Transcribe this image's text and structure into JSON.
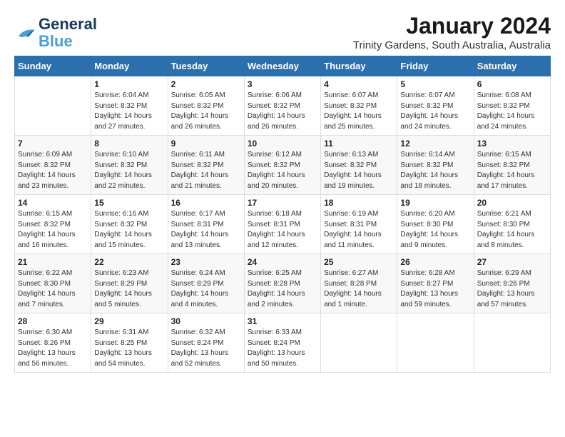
{
  "logo": {
    "line1": "General",
    "line2": "Blue"
  },
  "title": "January 2024",
  "subtitle": "Trinity Gardens, South Australia, Australia",
  "headers": [
    "Sunday",
    "Monday",
    "Tuesday",
    "Wednesday",
    "Thursday",
    "Friday",
    "Saturday"
  ],
  "weeks": [
    [
      {
        "day": "",
        "sunrise": "",
        "sunset": "",
        "daylight": ""
      },
      {
        "day": "1",
        "sunrise": "Sunrise: 6:04 AM",
        "sunset": "Sunset: 8:32 PM",
        "daylight": "Daylight: 14 hours and 27 minutes."
      },
      {
        "day": "2",
        "sunrise": "Sunrise: 6:05 AM",
        "sunset": "Sunset: 8:32 PM",
        "daylight": "Daylight: 14 hours and 26 minutes."
      },
      {
        "day": "3",
        "sunrise": "Sunrise: 6:06 AM",
        "sunset": "Sunset: 8:32 PM",
        "daylight": "Daylight: 14 hours and 26 minutes."
      },
      {
        "day": "4",
        "sunrise": "Sunrise: 6:07 AM",
        "sunset": "Sunset: 8:32 PM",
        "daylight": "Daylight: 14 hours and 25 minutes."
      },
      {
        "day": "5",
        "sunrise": "Sunrise: 6:07 AM",
        "sunset": "Sunset: 8:32 PM",
        "daylight": "Daylight: 14 hours and 24 minutes."
      },
      {
        "day": "6",
        "sunrise": "Sunrise: 6:08 AM",
        "sunset": "Sunset: 8:32 PM",
        "daylight": "Daylight: 14 hours and 24 minutes."
      }
    ],
    [
      {
        "day": "7",
        "sunrise": "Sunrise: 6:09 AM",
        "sunset": "Sunset: 8:32 PM",
        "daylight": "Daylight: 14 hours and 23 minutes."
      },
      {
        "day": "8",
        "sunrise": "Sunrise: 6:10 AM",
        "sunset": "Sunset: 8:32 PM",
        "daylight": "Daylight: 14 hours and 22 minutes."
      },
      {
        "day": "9",
        "sunrise": "Sunrise: 6:11 AM",
        "sunset": "Sunset: 8:32 PM",
        "daylight": "Daylight: 14 hours and 21 minutes."
      },
      {
        "day": "10",
        "sunrise": "Sunrise: 6:12 AM",
        "sunset": "Sunset: 8:32 PM",
        "daylight": "Daylight: 14 hours and 20 minutes."
      },
      {
        "day": "11",
        "sunrise": "Sunrise: 6:13 AM",
        "sunset": "Sunset: 8:32 PM",
        "daylight": "Daylight: 14 hours and 19 minutes."
      },
      {
        "day": "12",
        "sunrise": "Sunrise: 6:14 AM",
        "sunset": "Sunset: 8:32 PM",
        "daylight": "Daylight: 14 hours and 18 minutes."
      },
      {
        "day": "13",
        "sunrise": "Sunrise: 6:15 AM",
        "sunset": "Sunset: 8:32 PM",
        "daylight": "Daylight: 14 hours and 17 minutes."
      }
    ],
    [
      {
        "day": "14",
        "sunrise": "Sunrise: 6:15 AM",
        "sunset": "Sunset: 8:32 PM",
        "daylight": "Daylight: 14 hours and 16 minutes."
      },
      {
        "day": "15",
        "sunrise": "Sunrise: 6:16 AM",
        "sunset": "Sunset: 8:32 PM",
        "daylight": "Daylight: 14 hours and 15 minutes."
      },
      {
        "day": "16",
        "sunrise": "Sunrise: 6:17 AM",
        "sunset": "Sunset: 8:31 PM",
        "daylight": "Daylight: 14 hours and 13 minutes."
      },
      {
        "day": "17",
        "sunrise": "Sunrise: 6:18 AM",
        "sunset": "Sunset: 8:31 PM",
        "daylight": "Daylight: 14 hours and 12 minutes."
      },
      {
        "day": "18",
        "sunrise": "Sunrise: 6:19 AM",
        "sunset": "Sunset: 8:31 PM",
        "daylight": "Daylight: 14 hours and 11 minutes."
      },
      {
        "day": "19",
        "sunrise": "Sunrise: 6:20 AM",
        "sunset": "Sunset: 8:30 PM",
        "daylight": "Daylight: 14 hours and 9 minutes."
      },
      {
        "day": "20",
        "sunrise": "Sunrise: 6:21 AM",
        "sunset": "Sunset: 8:30 PM",
        "daylight": "Daylight: 14 hours and 8 minutes."
      }
    ],
    [
      {
        "day": "21",
        "sunrise": "Sunrise: 6:22 AM",
        "sunset": "Sunset: 8:30 PM",
        "daylight": "Daylight: 14 hours and 7 minutes."
      },
      {
        "day": "22",
        "sunrise": "Sunrise: 6:23 AM",
        "sunset": "Sunset: 8:29 PM",
        "daylight": "Daylight: 14 hours and 5 minutes."
      },
      {
        "day": "23",
        "sunrise": "Sunrise: 6:24 AM",
        "sunset": "Sunset: 8:29 PM",
        "daylight": "Daylight: 14 hours and 4 minutes."
      },
      {
        "day": "24",
        "sunrise": "Sunrise: 6:25 AM",
        "sunset": "Sunset: 8:28 PM",
        "daylight": "Daylight: 14 hours and 2 minutes."
      },
      {
        "day": "25",
        "sunrise": "Sunrise: 6:27 AM",
        "sunset": "Sunset: 8:28 PM",
        "daylight": "Daylight: 14 hours and 1 minute."
      },
      {
        "day": "26",
        "sunrise": "Sunrise: 6:28 AM",
        "sunset": "Sunset: 8:27 PM",
        "daylight": "Daylight: 13 hours and 59 minutes."
      },
      {
        "day": "27",
        "sunrise": "Sunrise: 6:29 AM",
        "sunset": "Sunset: 8:26 PM",
        "daylight": "Daylight: 13 hours and 57 minutes."
      }
    ],
    [
      {
        "day": "28",
        "sunrise": "Sunrise: 6:30 AM",
        "sunset": "Sunset: 8:26 PM",
        "daylight": "Daylight: 13 hours and 56 minutes."
      },
      {
        "day": "29",
        "sunrise": "Sunrise: 6:31 AM",
        "sunset": "Sunset: 8:25 PM",
        "daylight": "Daylight: 13 hours and 54 minutes."
      },
      {
        "day": "30",
        "sunrise": "Sunrise: 6:32 AM",
        "sunset": "Sunset: 8:24 PM",
        "daylight": "Daylight: 13 hours and 52 minutes."
      },
      {
        "day": "31",
        "sunrise": "Sunrise: 6:33 AM",
        "sunset": "Sunset: 8:24 PM",
        "daylight": "Daylight: 13 hours and 50 minutes."
      },
      {
        "day": "",
        "sunrise": "",
        "sunset": "",
        "daylight": ""
      },
      {
        "day": "",
        "sunrise": "",
        "sunset": "",
        "daylight": ""
      },
      {
        "day": "",
        "sunrise": "",
        "sunset": "",
        "daylight": ""
      }
    ]
  ]
}
